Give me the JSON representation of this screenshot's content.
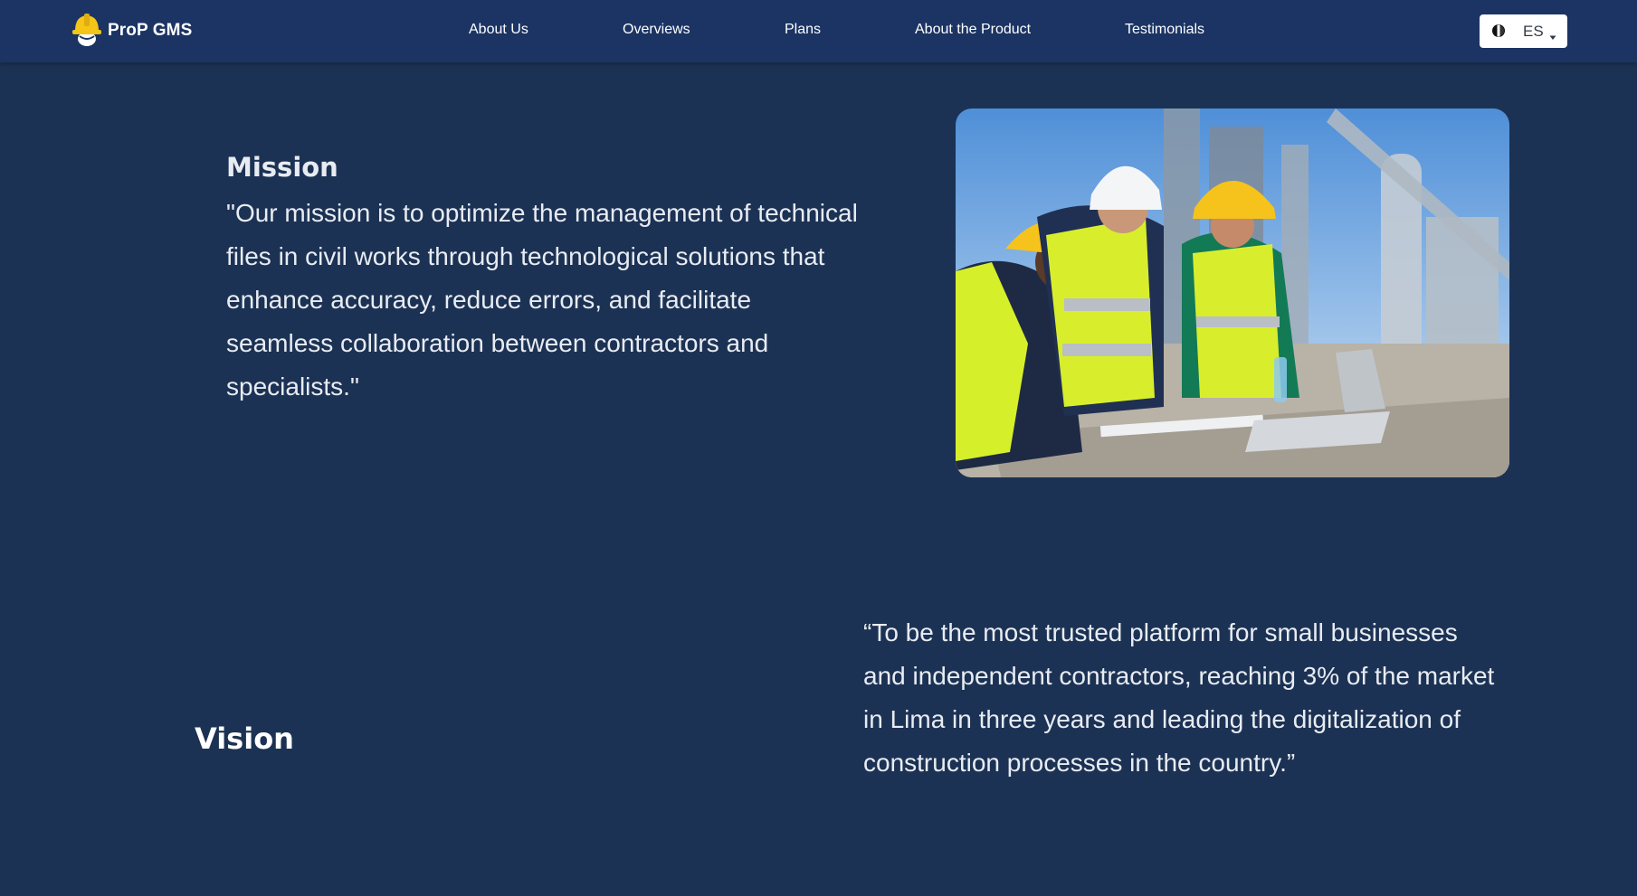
{
  "brand": {
    "name": "ProP GMS",
    "logo_icon": "hard-hat-icon",
    "logo_color": "#f5c518"
  },
  "nav": {
    "items": [
      {
        "label": "About Us"
      },
      {
        "label": "Overviews"
      },
      {
        "label": "Plans"
      },
      {
        "label": "About the Product"
      },
      {
        "label": "Testimonials"
      }
    ]
  },
  "language": {
    "selected": "ES",
    "flag_icon": "flag-icon",
    "caret_icon": "caret-down-icon"
  },
  "mission": {
    "heading": "Mission",
    "text": "\"Our mission is to optimize the management of technical files in civil works through technological solutions that enhance accuracy, reduce errors, and facilitate seamless collaboration between contractors and specialists.\""
  },
  "vision": {
    "heading": "Vision",
    "text": "“To be the most trusted platform for small businesses and independent contractors, reaching 3% of the market in Lima in three years and leading the digitalization of construction processes in the country.”"
  },
  "colors": {
    "navbar": "#1b3464",
    "background": "#1c3254",
    "text": "#e8ecf2",
    "accent_yellow": "#f5c518"
  }
}
